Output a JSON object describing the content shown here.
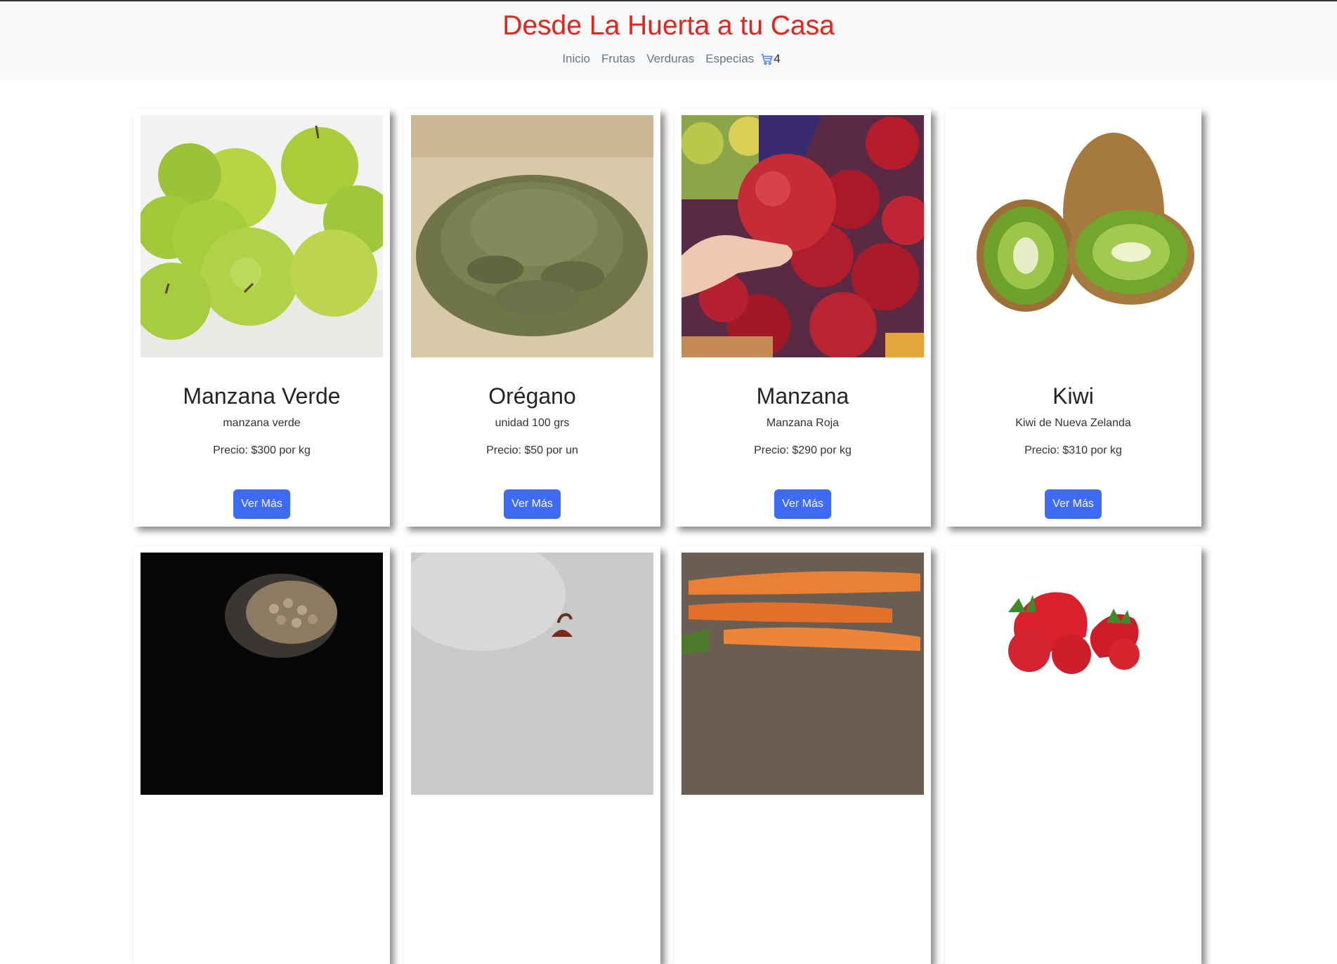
{
  "header": {
    "brand": "Desde La Huerta a tu Casa",
    "nav": [
      "Inicio",
      "Frutas",
      "Verduras",
      "Especias"
    ],
    "cart_count": "4"
  },
  "colors": {
    "brand": "#e8231a",
    "button": "#3d6bf5",
    "navbar_bg": "#f8f9fa"
  },
  "products": [
    {
      "title": "Manzana Verde",
      "desc": "manzana verde",
      "price": "Precio: $300 por kg",
      "button": "Ver Más",
      "image": "green-apples-image"
    },
    {
      "title": "Orégano",
      "desc": "unidad 100 grs",
      "price": "Precio: $50 por un",
      "button": "Ver Más",
      "image": "oregano-image"
    },
    {
      "title": "Manzana",
      "desc": "Manzana Roja",
      "price": "Precio: $290 por kg",
      "button": "Ver Más",
      "image": "red-apples-image"
    },
    {
      "title": "Kiwi",
      "desc": "Kiwi de Nueva Zelanda",
      "price": "Precio: $310 por kg",
      "button": "Ver Más",
      "image": "kiwi-image"
    },
    {
      "image": "pepper-jar-image"
    },
    {
      "image": "chili-pepper-image"
    },
    {
      "image": "carrots-image"
    },
    {
      "image": "strawberries-image"
    }
  ]
}
